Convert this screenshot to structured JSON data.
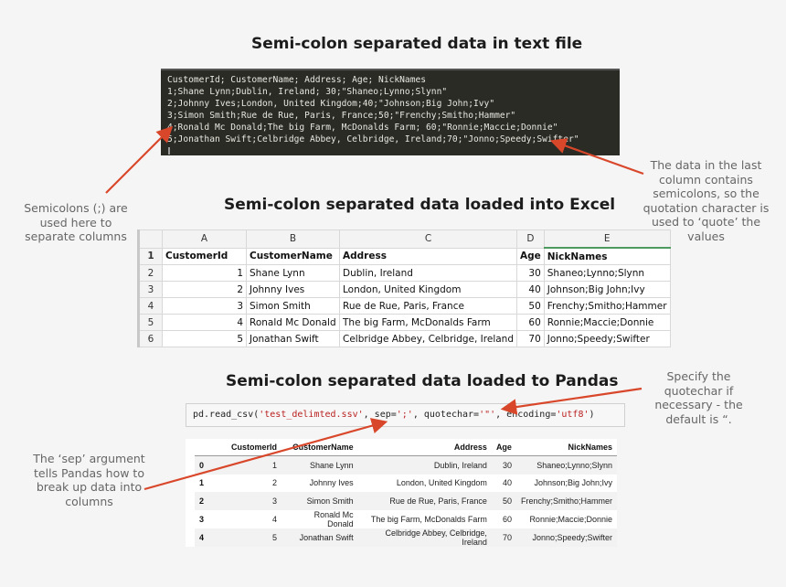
{
  "titles": {
    "text_file": "Semi-colon separated data in text file",
    "excel": "Semi-colon separated data loaded into Excel",
    "pandas": "Semi-colon separated data loaded to Pandas"
  },
  "terminal": {
    "lines": [
      "CustomerId; CustomerName; Address; Age; NickNames",
      "1;Shane Lynn;Dublin, Ireland; 30;\"Shaneo;Lynno;Slynn\"",
      "2;Johnny Ives;London, United Kingdom;40;\"Johnson;Big John;Ivy\"",
      "3;Simon Smith;Rue de Rue, Paris, France;50;\"Frenchy;Smitho;Hammer\"",
      "4;Ronald Mc Donald;The big Farm, McDonalds Farm; 60;\"Ronnie;Maccie;Donnie\"",
      "5;Jonathan Swift;Celbridge Abbey, Celbridge, Ireland;70;\"Jonno;Speedy;Swifter\""
    ]
  },
  "excel": {
    "column_letters": [
      "A",
      "B",
      "C",
      "D",
      "E"
    ],
    "row_numbers": [
      "1",
      "2",
      "3",
      "4",
      "5",
      "6"
    ],
    "header": [
      "CustomerId",
      "CustomerName",
      "Address",
      "Age",
      "NickNames"
    ],
    "rows": [
      [
        "1",
        "Shane Lynn",
        "Dublin, Ireland",
        "30",
        "Shaneo;Lynno;Slynn"
      ],
      [
        "2",
        "Johnny Ives",
        "London, United Kingdom",
        "40",
        "Johnson;Big John;Ivy"
      ],
      [
        "3",
        "Simon Smith",
        "Rue de Rue, Paris, France",
        "50",
        "Frenchy;Smitho;Hammer"
      ],
      [
        "4",
        "Ronald Mc Donald",
        "The big Farm, McDonalds Farm",
        "60",
        "Ronnie;Maccie;Donnie"
      ],
      [
        "5",
        "Jonathan Swift",
        "Celbridge Abbey, Celbridge, Ireland",
        "70",
        "Jonno;Speedy;Swifter"
      ]
    ]
  },
  "code": {
    "prefix": "pd.read_csv(",
    "filename": "'test_delimted.ssv'",
    "sep_label": ", sep=",
    "sep_value": "';'",
    "quote_label": ", quotechar=",
    "quote_value": "'\"'",
    "enc_label": ", encoding=",
    "enc_value": "'utf8'",
    "suffix": ")"
  },
  "pandas": {
    "header": [
      "",
      "CustomerId",
      "CustomerName",
      "Address",
      "Age",
      "NickNames"
    ],
    "rows": [
      [
        "0",
        "1",
        "Shane Lynn",
        "Dublin, Ireland",
        "30",
        "Shaneo;Lynno;Slynn"
      ],
      [
        "1",
        "2",
        "Johnny Ives",
        "London, United Kingdom",
        "40",
        "Johnson;Big John;Ivy"
      ],
      [
        "2",
        "3",
        "Simon Smith",
        "Rue de Rue, Paris, France",
        "50",
        "Frenchy;Smitho;Hammer"
      ],
      [
        "3",
        "4",
        "Ronald Mc Donald",
        "The big Farm, McDonalds Farm",
        "60",
        "Ronnie;Maccie;Donnie"
      ],
      [
        "4",
        "5",
        "Jonathan Swift",
        "Celbridge Abbey, Celbridge, Ireland",
        "70",
        "Jonno;Speedy;Swifter"
      ]
    ]
  },
  "notes": {
    "semicolons": "Semicolons (;) are used here to separate columns",
    "quotation": "The data in the last column contains semicolons, so the quotation character is used to ‘quote’ the values",
    "quotechar": "Specify the quotechar if necessary - the default is “.",
    "sep": "The ‘sep’ argument tells Pandas how to break up data into columns"
  },
  "colors": {
    "arrow": "#d9472b",
    "terminal_bg": "#2b2b26",
    "code_string": "#ba2121",
    "excel_selected_column": "#1f7a3d"
  }
}
